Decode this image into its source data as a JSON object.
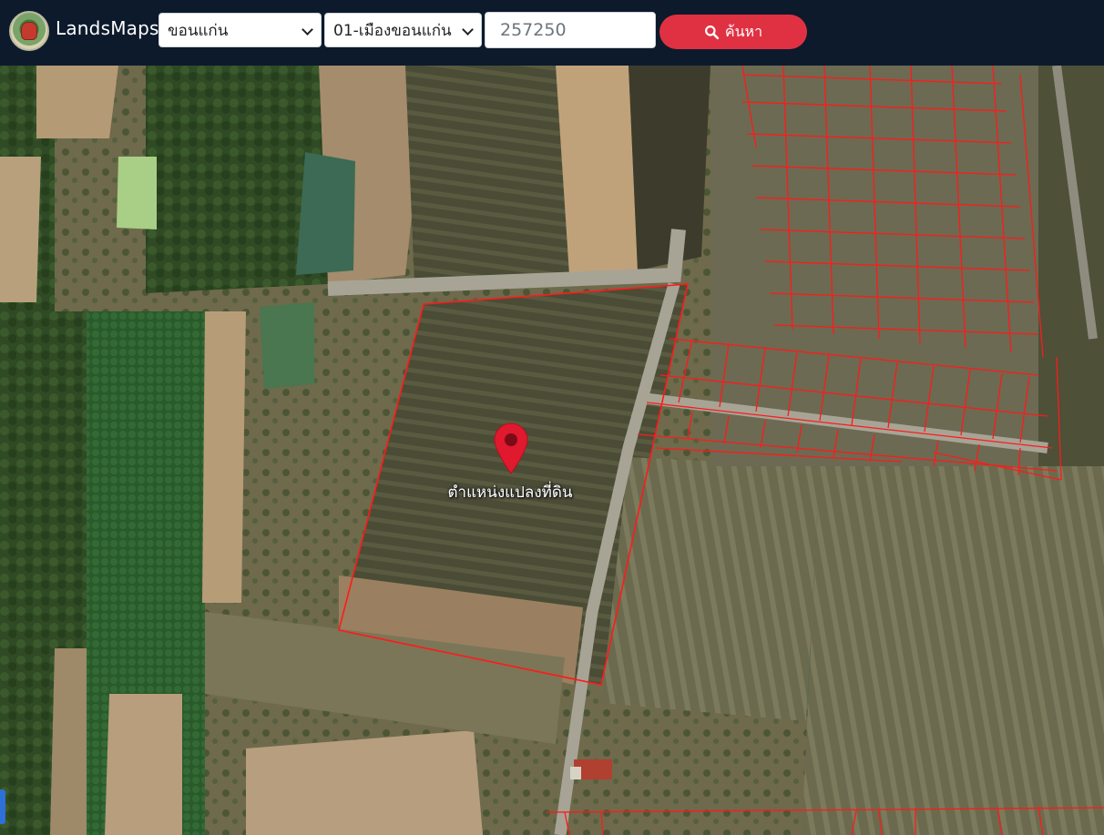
{
  "app": {
    "brand": "LandsMaps"
  },
  "search": {
    "province_selected": "ขอนแก่น",
    "district_selected": "01-เมืองขอนแก่น",
    "parcel_value": "257250",
    "button_label": "ค้นหา"
  },
  "map": {
    "marker_label": "ตำแหน่งแปลงที่ดิน",
    "parcel_outline_color": "#ff1a1a",
    "marker_color": "#e0192e"
  },
  "colors": {
    "topbar": "#0c1a2c",
    "search_button": "#e03142"
  }
}
